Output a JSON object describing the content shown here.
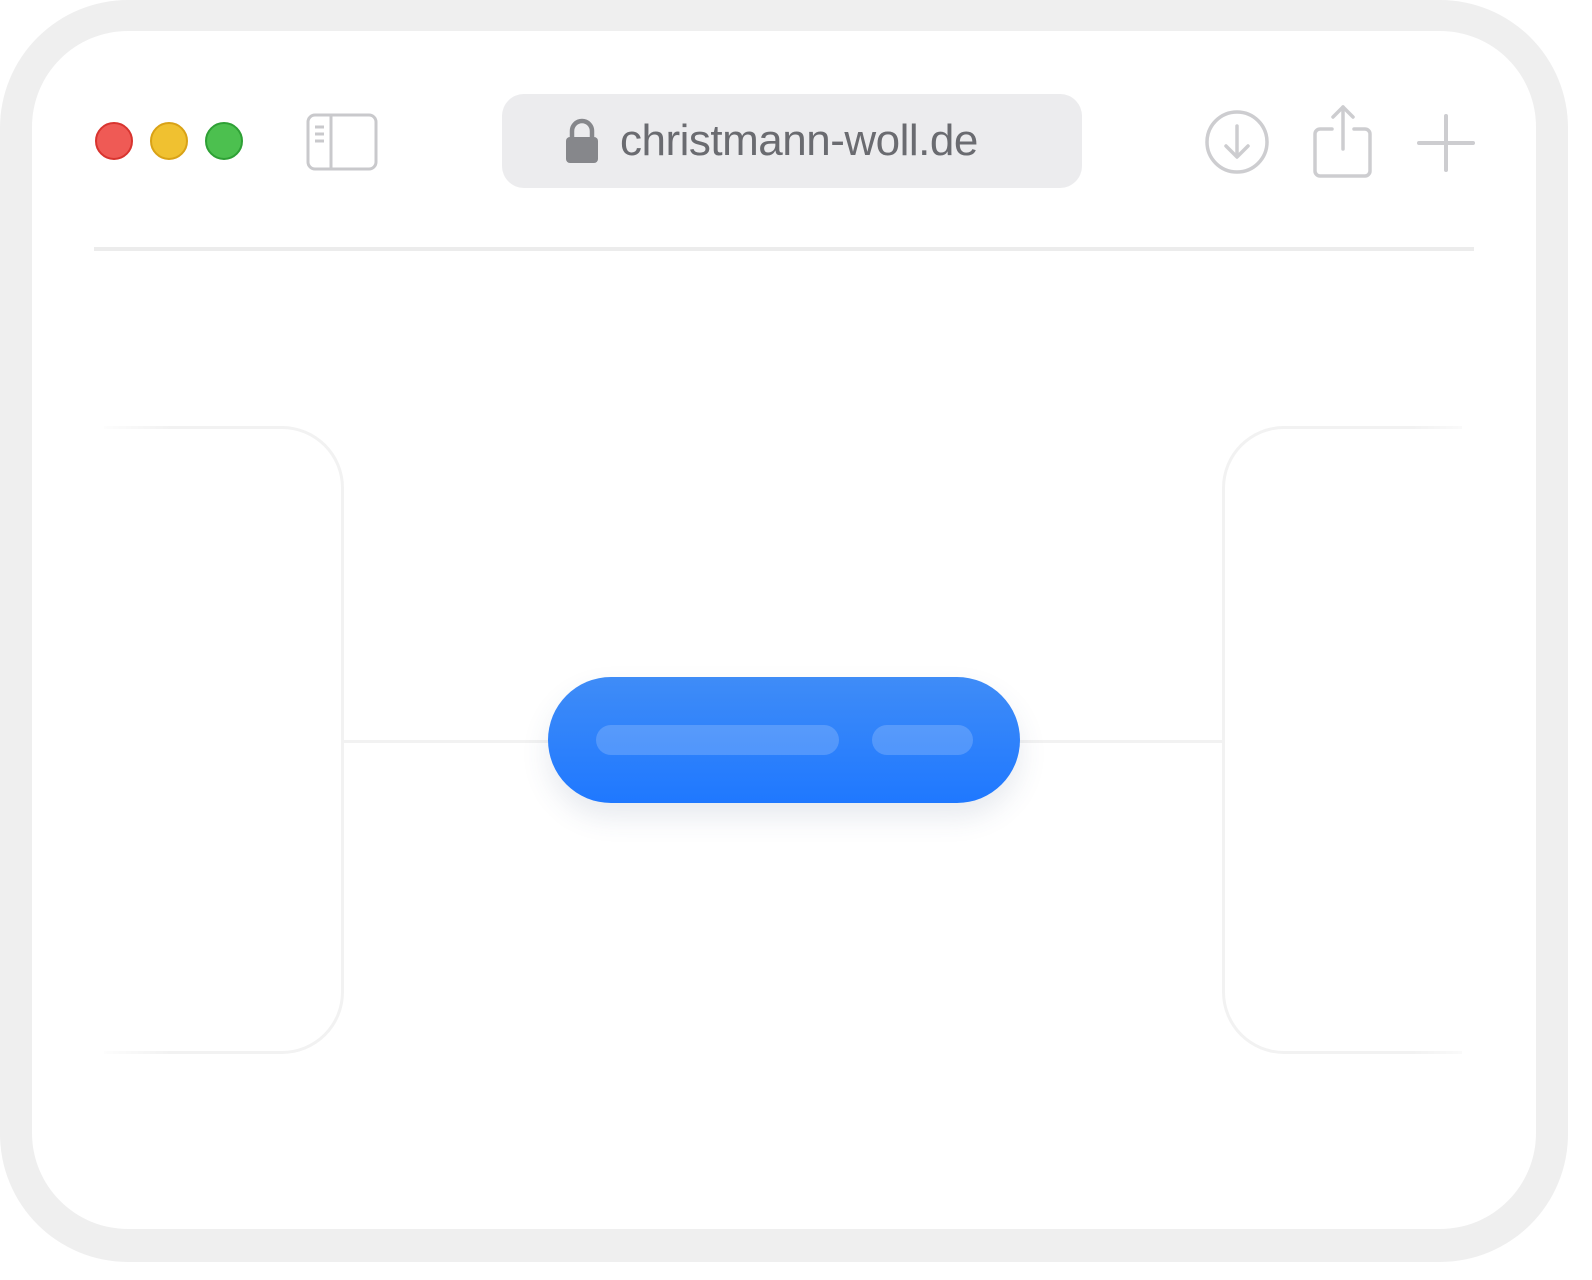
{
  "browser": {
    "address_bar": {
      "url": "christmann-woll.de",
      "secure": true
    },
    "icons": {
      "sidebar": "sidebar-toggle-icon",
      "lock": "lock-icon",
      "download": "download-icon",
      "share": "share-icon",
      "new_tab": "plus-icon"
    },
    "traffic_lights": {
      "close_color": "#ef5a55",
      "minimize_color": "#f0c130",
      "zoom_color": "#4cc04f"
    }
  },
  "content": {
    "primary_button_color": "#1f78ff"
  }
}
